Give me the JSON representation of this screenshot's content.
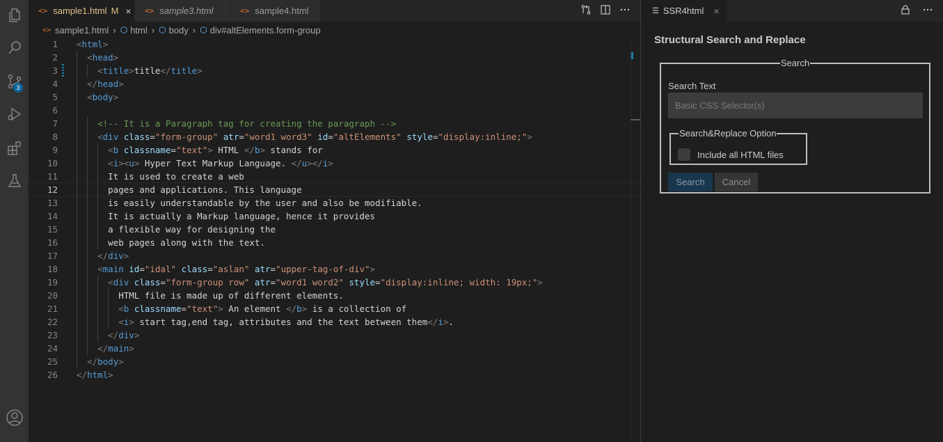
{
  "activity_bar": {
    "items": [
      "explorer-icon",
      "search-icon",
      "source-control-icon",
      "run-debug-icon",
      "extensions-icon",
      "testing-icon",
      "account-icon"
    ],
    "source_control_badge": "3"
  },
  "tabs": [
    {
      "label": "sample1.html",
      "modified": "M",
      "close": "×"
    },
    {
      "label": "sample3.html"
    },
    {
      "label": "sample4.html"
    }
  ],
  "breadcrumb": [
    "sample1.html",
    "html",
    "body",
    "div#altElements.form-group"
  ],
  "line_numbers": [
    "1",
    "2",
    "3",
    "4",
    "5",
    "6",
    "7",
    "8",
    "9",
    "10",
    "11",
    "12",
    "13",
    "14",
    "15",
    "16",
    "17",
    "18",
    "19",
    "20",
    "21",
    "22",
    "23",
    "24",
    "25",
    "26"
  ],
  "current_line": "12",
  "code_lines": [
    [
      [
        "p",
        "<"
      ],
      [
        "t",
        "html"
      ],
      [
        "p",
        ">"
      ]
    ],
    [
      [
        "x",
        "  "
      ],
      [
        "p",
        "<"
      ],
      [
        "t",
        "head"
      ],
      [
        "p",
        ">"
      ]
    ],
    [
      [
        "x",
        "    "
      ],
      [
        "p",
        "<"
      ],
      [
        "t",
        "title"
      ],
      [
        "p",
        ">"
      ],
      [
        "x",
        "title"
      ],
      [
        "p",
        "</"
      ],
      [
        "t",
        "title"
      ],
      [
        "p",
        ">"
      ]
    ],
    [
      [
        "x",
        "  "
      ],
      [
        "p",
        "</"
      ],
      [
        "t",
        "head"
      ],
      [
        "p",
        ">"
      ]
    ],
    [
      [
        "x",
        "  "
      ],
      [
        "p",
        "<"
      ],
      [
        "t",
        "body"
      ],
      [
        "p",
        ">"
      ]
    ],
    [],
    [
      [
        "x",
        "    "
      ],
      [
        "c",
        "<!-- It is a Paragraph tag for creating the paragraph -->"
      ]
    ],
    [
      [
        "x",
        "    "
      ],
      [
        "p",
        "<"
      ],
      [
        "t",
        "div"
      ],
      [
        "x",
        " "
      ],
      [
        "a",
        "class"
      ],
      [
        "x",
        "="
      ],
      [
        "s",
        "\"form-group\""
      ],
      [
        "x",
        " "
      ],
      [
        "a",
        "atr"
      ],
      [
        "x",
        "="
      ],
      [
        "s",
        "\"word1 word3\""
      ],
      [
        "x",
        " "
      ],
      [
        "a",
        "id"
      ],
      [
        "x",
        "="
      ],
      [
        "s",
        "\"altElements\""
      ],
      [
        "x",
        " "
      ],
      [
        "a",
        "style"
      ],
      [
        "x",
        "="
      ],
      [
        "s",
        "\"display:inline;\""
      ],
      [
        "p",
        ">"
      ]
    ],
    [
      [
        "x",
        "      "
      ],
      [
        "p",
        "<"
      ],
      [
        "t",
        "b"
      ],
      [
        "x",
        " "
      ],
      [
        "a",
        "classname"
      ],
      [
        "x",
        "="
      ],
      [
        "s",
        "\"text\""
      ],
      [
        "p",
        ">"
      ],
      [
        "x",
        " HTML "
      ],
      [
        "p",
        "</"
      ],
      [
        "t",
        "b"
      ],
      [
        "p",
        ">"
      ],
      [
        "x",
        " stands for"
      ]
    ],
    [
      [
        "x",
        "      "
      ],
      [
        "p",
        "<"
      ],
      [
        "t",
        "i"
      ],
      [
        "p",
        "><"
      ],
      [
        "t",
        "u"
      ],
      [
        "p",
        ">"
      ],
      [
        "x",
        " Hyper Text Markup Language. "
      ],
      [
        "p",
        "</"
      ],
      [
        "t",
        "u"
      ],
      [
        "p",
        "></"
      ],
      [
        "t",
        "i"
      ],
      [
        "p",
        ">"
      ]
    ],
    [
      [
        "x",
        "      It is used to create a web"
      ]
    ],
    [
      [
        "x",
        "      pages and applications. This language"
      ]
    ],
    [
      [
        "x",
        "      is easily understandable by the user and also be modifiable."
      ]
    ],
    [
      [
        "x",
        "      It is actually a Markup language, hence it provides"
      ]
    ],
    [
      [
        "x",
        "      a flexible way for designing the"
      ]
    ],
    [
      [
        "x",
        "      web pages along with the text."
      ]
    ],
    [
      [
        "x",
        "    "
      ],
      [
        "p",
        "</"
      ],
      [
        "t",
        "div"
      ],
      [
        "p",
        ">"
      ]
    ],
    [
      [
        "x",
        "    "
      ],
      [
        "p",
        "<"
      ],
      [
        "t",
        "main"
      ],
      [
        "x",
        " "
      ],
      [
        "a",
        "id"
      ],
      [
        "x",
        "="
      ],
      [
        "s",
        "\"idal\""
      ],
      [
        "x",
        " "
      ],
      [
        "a",
        "class"
      ],
      [
        "x",
        "="
      ],
      [
        "s",
        "\"aslan\""
      ],
      [
        "x",
        " "
      ],
      [
        "a",
        "atr"
      ],
      [
        "x",
        "="
      ],
      [
        "s",
        "\"upper-tag-of-div\""
      ],
      [
        "p",
        ">"
      ]
    ],
    [
      [
        "x",
        "      "
      ],
      [
        "p",
        "<"
      ],
      [
        "t",
        "div"
      ],
      [
        "x",
        " "
      ],
      [
        "a",
        "class"
      ],
      [
        "x",
        "="
      ],
      [
        "s",
        "\"form-group row\""
      ],
      [
        "x",
        " "
      ],
      [
        "a",
        "atr"
      ],
      [
        "x",
        "="
      ],
      [
        "s",
        "\"word1 word2\""
      ],
      [
        "x",
        " "
      ],
      [
        "a",
        "style"
      ],
      [
        "x",
        "="
      ],
      [
        "s",
        "\"display:inline; width: 19px;\""
      ],
      [
        "p",
        ">"
      ]
    ],
    [
      [
        "x",
        "        HTML file is made up of different elements."
      ]
    ],
    [
      [
        "x",
        "        "
      ],
      [
        "p",
        "<"
      ],
      [
        "t",
        "b"
      ],
      [
        "x",
        " "
      ],
      [
        "a",
        "classname"
      ],
      [
        "x",
        "="
      ],
      [
        "s",
        "\"text\""
      ],
      [
        "p",
        ">"
      ],
      [
        "x",
        " An element "
      ],
      [
        "p",
        "</"
      ],
      [
        "t",
        "b"
      ],
      [
        "p",
        ">"
      ],
      [
        "x",
        " is a collection of"
      ]
    ],
    [
      [
        "x",
        "        "
      ],
      [
        "p",
        "<"
      ],
      [
        "t",
        "i"
      ],
      [
        "p",
        ">"
      ],
      [
        "x",
        " start tag,end tag, attributes and the text between them"
      ],
      [
        "p",
        "</"
      ],
      [
        "t",
        "i"
      ],
      [
        "p",
        ">"
      ],
      [
        "x",
        "."
      ]
    ],
    [
      [
        "x",
        "      "
      ],
      [
        "p",
        "</"
      ],
      [
        "t",
        "div"
      ],
      [
        "p",
        ">"
      ]
    ],
    [
      [
        "x",
        "    "
      ],
      [
        "p",
        "</"
      ],
      [
        "t",
        "main"
      ],
      [
        "p",
        ">"
      ]
    ],
    [
      [
        "x",
        "  "
      ],
      [
        "p",
        "</"
      ],
      [
        "t",
        "body"
      ],
      [
        "p",
        ">"
      ]
    ],
    [
      [
        "p",
        "</"
      ],
      [
        "t",
        "html"
      ],
      [
        "p",
        ">"
      ]
    ]
  ],
  "panel": {
    "tab_label": "SSR4html",
    "tab_close": "×",
    "title": "Structural Search and Replace",
    "search_legend": "Search",
    "search_text_label": "Search Text",
    "search_placeholder": "Basic CSS Selector(s)",
    "option_legend": "Search&Replace Option",
    "include_label": "Include all HTML files",
    "search_button": "Search",
    "cancel_button": "Cancel"
  },
  "colors": {
    "tag": "#569cd6",
    "punct": "#808080",
    "attr": "#9cdcfe",
    "string": "#ce9178",
    "comment": "#6a9955",
    "modified_tab": "#e2c08d",
    "badge": "#0e639c"
  }
}
